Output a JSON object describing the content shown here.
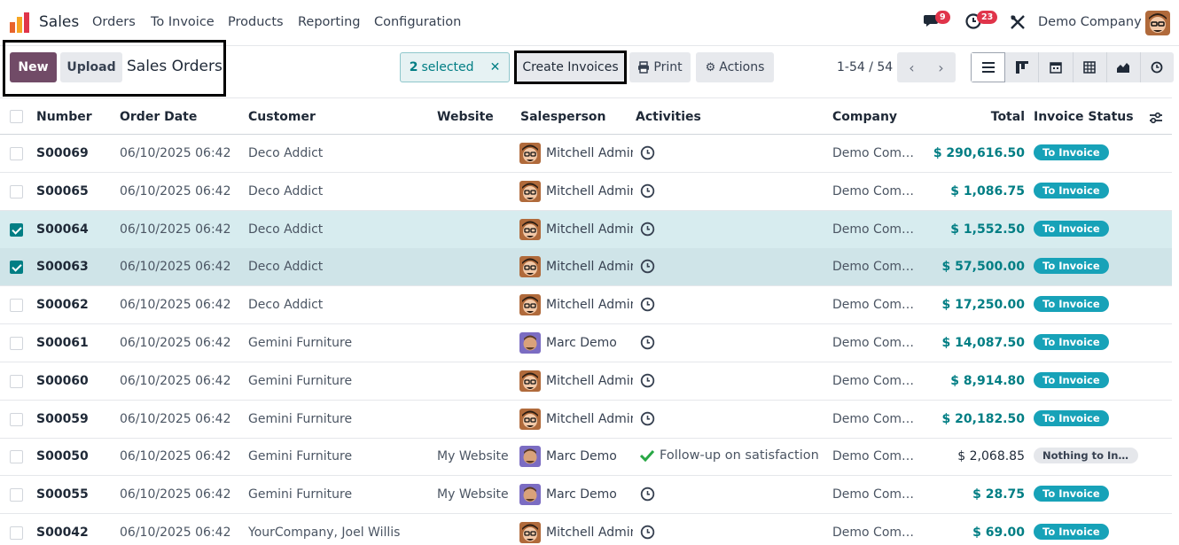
{
  "nav": {
    "app_name": "Sales",
    "menu": [
      "Orders",
      "To Invoice",
      "Products",
      "Reporting",
      "Configuration"
    ],
    "messages_count": "9",
    "activities_count": "23",
    "company": "Demo Company"
  },
  "control": {
    "new_label": "New",
    "upload_label": "Upload",
    "title": "Sales Orders",
    "selected_count": "2",
    "selected_label": "selected",
    "create_invoices_label": "Create Invoices",
    "print_label": "Print",
    "actions_label": "Actions",
    "pager": "1-54 / 54"
  },
  "columns": [
    "Number",
    "Order Date",
    "Customer",
    "Website",
    "Salesperson",
    "Activities",
    "Company",
    "Total",
    "Invoice Status"
  ],
  "rows": [
    {
      "number": "S00069",
      "date": "06/10/2025 06:42",
      "customer": "Deco Addict",
      "website": "",
      "salesperson": "Mitchell Admin",
      "avatar": "mitchell",
      "activity": "",
      "company": "Demo Company",
      "total": "$ 290,616.50",
      "status": "To Invoice",
      "checked": false
    },
    {
      "number": "S00065",
      "date": "06/10/2025 06:42",
      "customer": "Deco Addict",
      "website": "",
      "salesperson": "Mitchell Admin",
      "avatar": "mitchell",
      "activity": "",
      "company": "Demo Company",
      "total": "$ 1,086.75",
      "status": "To Invoice",
      "checked": false
    },
    {
      "number": "S00064",
      "date": "06/10/2025 06:42",
      "customer": "Deco Addict",
      "website": "",
      "salesperson": "Mitchell Admin",
      "avatar": "mitchell",
      "activity": "",
      "company": "Demo Company",
      "total": "$ 1,552.50",
      "status": "To Invoice",
      "checked": true
    },
    {
      "number": "S00063",
      "date": "06/10/2025 06:42",
      "customer": "Deco Addict",
      "website": "",
      "salesperson": "Mitchell Admin",
      "avatar": "mitchell",
      "activity": "",
      "company": "Demo Company",
      "total": "$ 57,500.00",
      "status": "To Invoice",
      "checked": true
    },
    {
      "number": "S00062",
      "date": "06/10/2025 06:42",
      "customer": "Deco Addict",
      "website": "",
      "salesperson": "Mitchell Admin",
      "avatar": "mitchell",
      "activity": "",
      "company": "Demo Company",
      "total": "$ 17,250.00",
      "status": "To Invoice",
      "checked": false
    },
    {
      "number": "S00061",
      "date": "06/10/2025 06:42",
      "customer": "Gemini Furniture",
      "website": "",
      "salesperson": "Marc Demo",
      "avatar": "marc",
      "activity": "",
      "company": "Demo Company",
      "total": "$ 14,087.50",
      "status": "To Invoice",
      "checked": false
    },
    {
      "number": "S00060",
      "date": "06/10/2025 06:42",
      "customer": "Gemini Furniture",
      "website": "",
      "salesperson": "Mitchell Admin",
      "avatar": "mitchell",
      "activity": "",
      "company": "Demo Company",
      "total": "$ 8,914.80",
      "status": "To Invoice",
      "checked": false
    },
    {
      "number": "S00059",
      "date": "06/10/2025 06:42",
      "customer": "Gemini Furniture",
      "website": "",
      "salesperson": "Mitchell Admin",
      "avatar": "mitchell",
      "activity": "",
      "company": "Demo Company",
      "total": "$ 20,182.50",
      "status": "To Invoice",
      "checked": false
    },
    {
      "number": "S00050",
      "date": "06/10/2025 06:42",
      "customer": "Gemini Furniture",
      "website": "My Website",
      "salesperson": "Marc Demo",
      "avatar": "marc",
      "activity": "Follow-up on satisfaction",
      "company": "Demo Company",
      "total": "$ 2,068.85",
      "status": "Nothing to Invoice",
      "checked": false
    },
    {
      "number": "S00055",
      "date": "06/10/2025 06:42",
      "customer": "Gemini Furniture",
      "website": "My Website",
      "salesperson": "Marc Demo",
      "avatar": "marc",
      "activity": "",
      "company": "Demo Company",
      "total": "$ 28.75",
      "status": "To Invoice",
      "checked": false
    },
    {
      "number": "S00042",
      "date": "06/10/2025 06:42",
      "customer": "YourCompany, Joel Willis",
      "website": "",
      "salesperson": "Mitchell Admin",
      "avatar": "mitchell",
      "activity": "",
      "company": "Demo Company",
      "total": "$ 69.00",
      "status": "To Invoice",
      "checked": false
    }
  ]
}
